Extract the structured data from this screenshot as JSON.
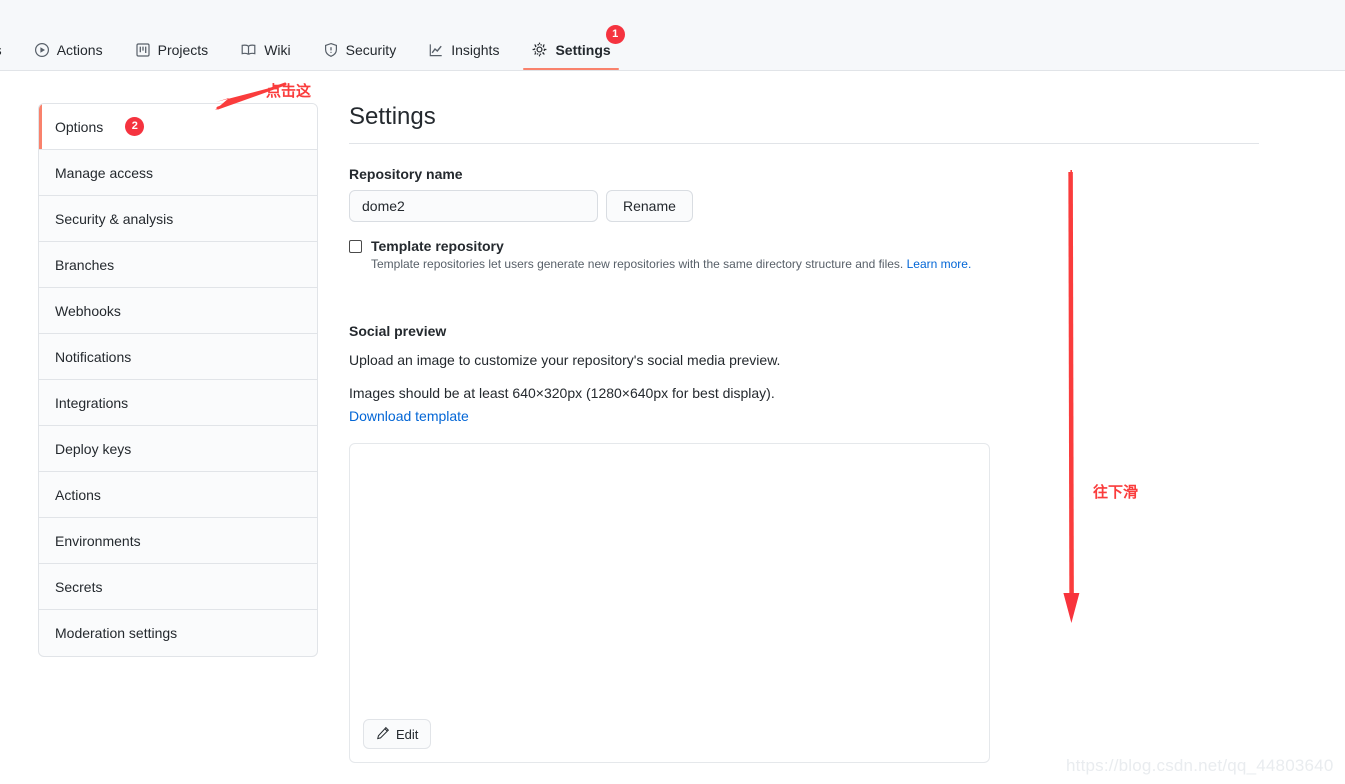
{
  "nav": {
    "items": [
      {
        "label": "ests",
        "icon": "pull-request-icon",
        "selected": false,
        "badge": null,
        "partial": true
      },
      {
        "label": "Actions",
        "icon": "play-circle-icon",
        "selected": false,
        "badge": null
      },
      {
        "label": "Projects",
        "icon": "project-board-icon",
        "selected": false,
        "badge": null
      },
      {
        "label": "Wiki",
        "icon": "book-icon",
        "selected": false,
        "badge": null
      },
      {
        "label": "Security",
        "icon": "shield-icon",
        "selected": false,
        "badge": null
      },
      {
        "label": "Insights",
        "icon": "graph-icon",
        "selected": false,
        "badge": null
      },
      {
        "label": "Settings",
        "icon": "gear-icon",
        "selected": true,
        "badge": "1"
      }
    ]
  },
  "sidebar": {
    "items": [
      {
        "label": "Options",
        "active": true,
        "badge": "2"
      },
      {
        "label": "Manage access",
        "active": false,
        "badge": null
      },
      {
        "label": "Security & analysis",
        "active": false,
        "badge": null
      },
      {
        "label": "Branches",
        "active": false,
        "badge": null
      },
      {
        "label": "Webhooks",
        "active": false,
        "badge": null
      },
      {
        "label": "Notifications",
        "active": false,
        "badge": null
      },
      {
        "label": "Integrations",
        "active": false,
        "badge": null
      },
      {
        "label": "Deploy keys",
        "active": false,
        "badge": null
      },
      {
        "label": "Actions",
        "active": false,
        "badge": null
      },
      {
        "label": "Environments",
        "active": false,
        "badge": null
      },
      {
        "label": "Secrets",
        "active": false,
        "badge": null
      },
      {
        "label": "Moderation settings",
        "active": false,
        "badge": null
      }
    ]
  },
  "main": {
    "title": "Settings",
    "repository_name": {
      "label": "Repository name",
      "value": "dome2",
      "placeholder": "Repository name",
      "rename_button": "Rename"
    },
    "template_repository": {
      "label": "Template repository",
      "checked": false,
      "help_text": "Template repositories let users generate new repositories with the same directory structure and files.",
      "help_link": "Learn more."
    },
    "social_preview": {
      "heading": "Social preview",
      "description": "Upload an image to customize your repository's social media preview.",
      "size_note": "Images should be at least 640×320px (1280×640px for best display).",
      "download_link": "Download template",
      "edit_button": "Edit"
    }
  },
  "annotations": {
    "click_here": "点击这",
    "scroll_down": "往下滑"
  },
  "watermark": "https://blog.csdn.net/qq_44803640",
  "colors": {
    "accent_orange": "#f9826c",
    "badge_red": "#f5333f",
    "annotation_red": "#fa3c3c",
    "link_blue": "#0366d6",
    "header_bg": "#f6f8fa",
    "border": "#e1e4e8"
  }
}
